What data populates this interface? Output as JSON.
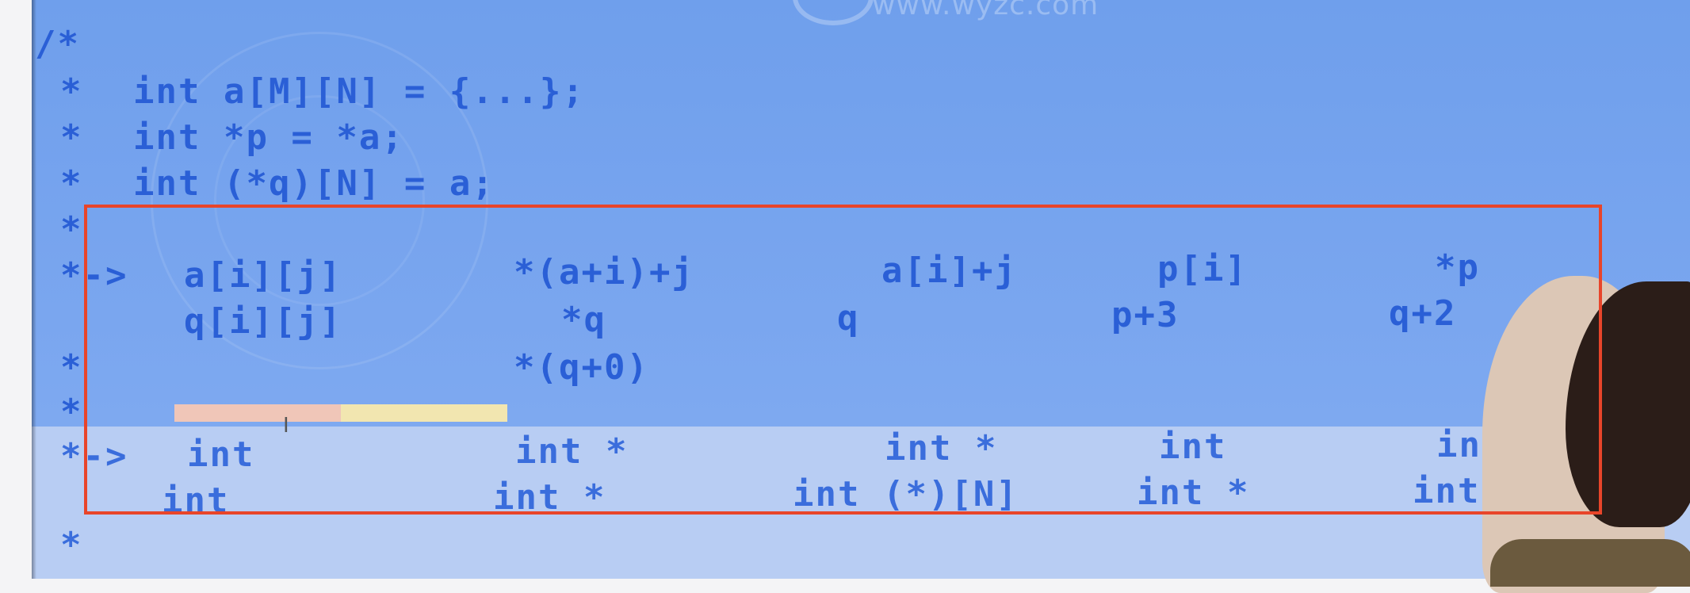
{
  "watermark": "www.wyzc.com",
  "editor": {
    "comment_open": "/*",
    "star": "*",
    "arrow": "*->",
    "decl_1": "int a[M][N] = {...};",
    "decl_2": "int *p = *a;",
    "decl_3": "int (*q)[N] = a;"
  },
  "expressions": {
    "row1": [
      "a[i][j]",
      "*(a+i)+j",
      "a[i]+j",
      "p[i]",
      "*p"
    ],
    "row2": [
      "q[i][j]",
      "*q",
      "q",
      "p+3",
      "q+2"
    ],
    "row3": [
      "*(q+0)"
    ]
  },
  "types": {
    "row1": [
      "int",
      "int *",
      "int *",
      "int",
      "int"
    ],
    "row2": [
      "int",
      "int *",
      "int (*)[N]",
      "int *",
      "int (*)[N"
    ]
  },
  "colors": {
    "code": "#2a5fd6",
    "background": "#7aa6ef",
    "highlight_box": "#e8452a"
  }
}
